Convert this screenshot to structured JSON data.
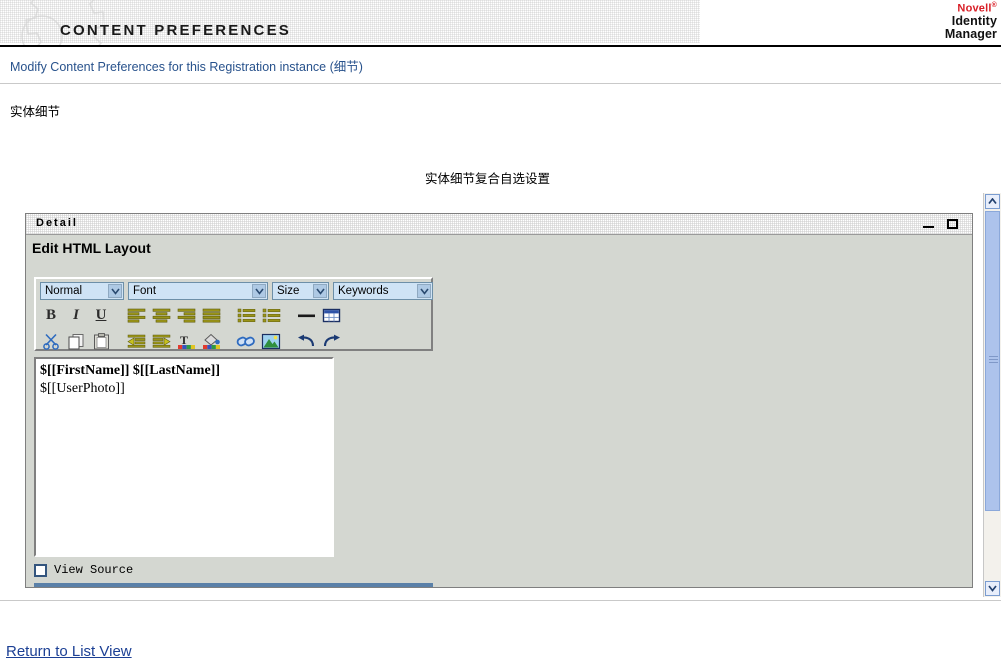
{
  "header": {
    "title": "CONTENT PREFERENCES",
    "gear_icon": "gear-icon",
    "brand": {
      "company": "Novell",
      "registered": "®",
      "product_line1": "Identity",
      "product_line2": "Manager"
    }
  },
  "subtitle": "Modify Content Preferences for this Registration instance (细节)",
  "page": {
    "entity_detail_label": "实体细节",
    "composite_label": "实体细节复合自选设置"
  },
  "detail_panel": {
    "title": "Detail",
    "minimize_label": "—",
    "maximize_label": "□",
    "heading": "Edit HTML Layout",
    "toolbar": {
      "selects": [
        {
          "name": "style",
          "value": "Normal"
        },
        {
          "name": "font",
          "value": "Font"
        },
        {
          "name": "size",
          "value": "Size"
        },
        {
          "name": "keywords",
          "value": "Keywords"
        }
      ],
      "row1": [
        {
          "icon": "bold-icon",
          "label": "B"
        },
        {
          "icon": "italic-icon",
          "label": "I"
        },
        {
          "icon": "underline-icon",
          "label": "U"
        },
        {
          "icon": "align-left-icon",
          "label": ""
        },
        {
          "icon": "align-center-icon",
          "label": ""
        },
        {
          "icon": "align-right-icon",
          "label": ""
        },
        {
          "icon": "align-justify-icon",
          "label": ""
        },
        {
          "icon": "numbered-list-icon",
          "label": ""
        },
        {
          "icon": "bulleted-list-icon",
          "label": ""
        },
        {
          "icon": "horizontal-rule-icon",
          "label": ""
        },
        {
          "icon": "table-icon",
          "label": ""
        }
      ],
      "row2": [
        {
          "icon": "cut-scissors-icon",
          "label": ""
        },
        {
          "icon": "copy-icon",
          "label": ""
        },
        {
          "icon": "paste-clipboard-icon",
          "label": ""
        },
        {
          "icon": "outdent-icon",
          "label": ""
        },
        {
          "icon": "indent-icon",
          "label": ""
        },
        {
          "icon": "text-color-icon",
          "label": ""
        },
        {
          "icon": "fill-color-icon",
          "label": ""
        },
        {
          "icon": "hyperlink-icon",
          "label": ""
        },
        {
          "icon": "insert-image-icon",
          "label": ""
        },
        {
          "icon": "undo-icon",
          "label": ""
        },
        {
          "icon": "redo-icon",
          "label": ""
        }
      ]
    },
    "editor": {
      "line1": "$[[FirstName]] $[[LastName]]",
      "line2": "$[[UserPhoto]]"
    },
    "view_source": {
      "label": "View Source",
      "checked": false
    },
    "action_bar": {
      "buttons": [
        {
          "name": "save-button",
          "icon": "floppy-disk-icon"
        },
        {
          "name": "layout-button",
          "icon": "layout-icon"
        }
      ]
    }
  },
  "scrollbar": {
    "up_icon": "chevron-up-icon",
    "down_icon": "chevron-down-icon"
  },
  "footer": {
    "return_link": "Return to List View"
  },
  "colors": {
    "brand_red": "#d81e26",
    "link_blue": "#1b3f94",
    "subtitle_blue": "#28528c",
    "panel_gray": "#d4d7d1",
    "action_bar_blue": "#5a80a8",
    "select_blue": "#cfe3f5",
    "toolbar_olive": "#9a9418"
  }
}
